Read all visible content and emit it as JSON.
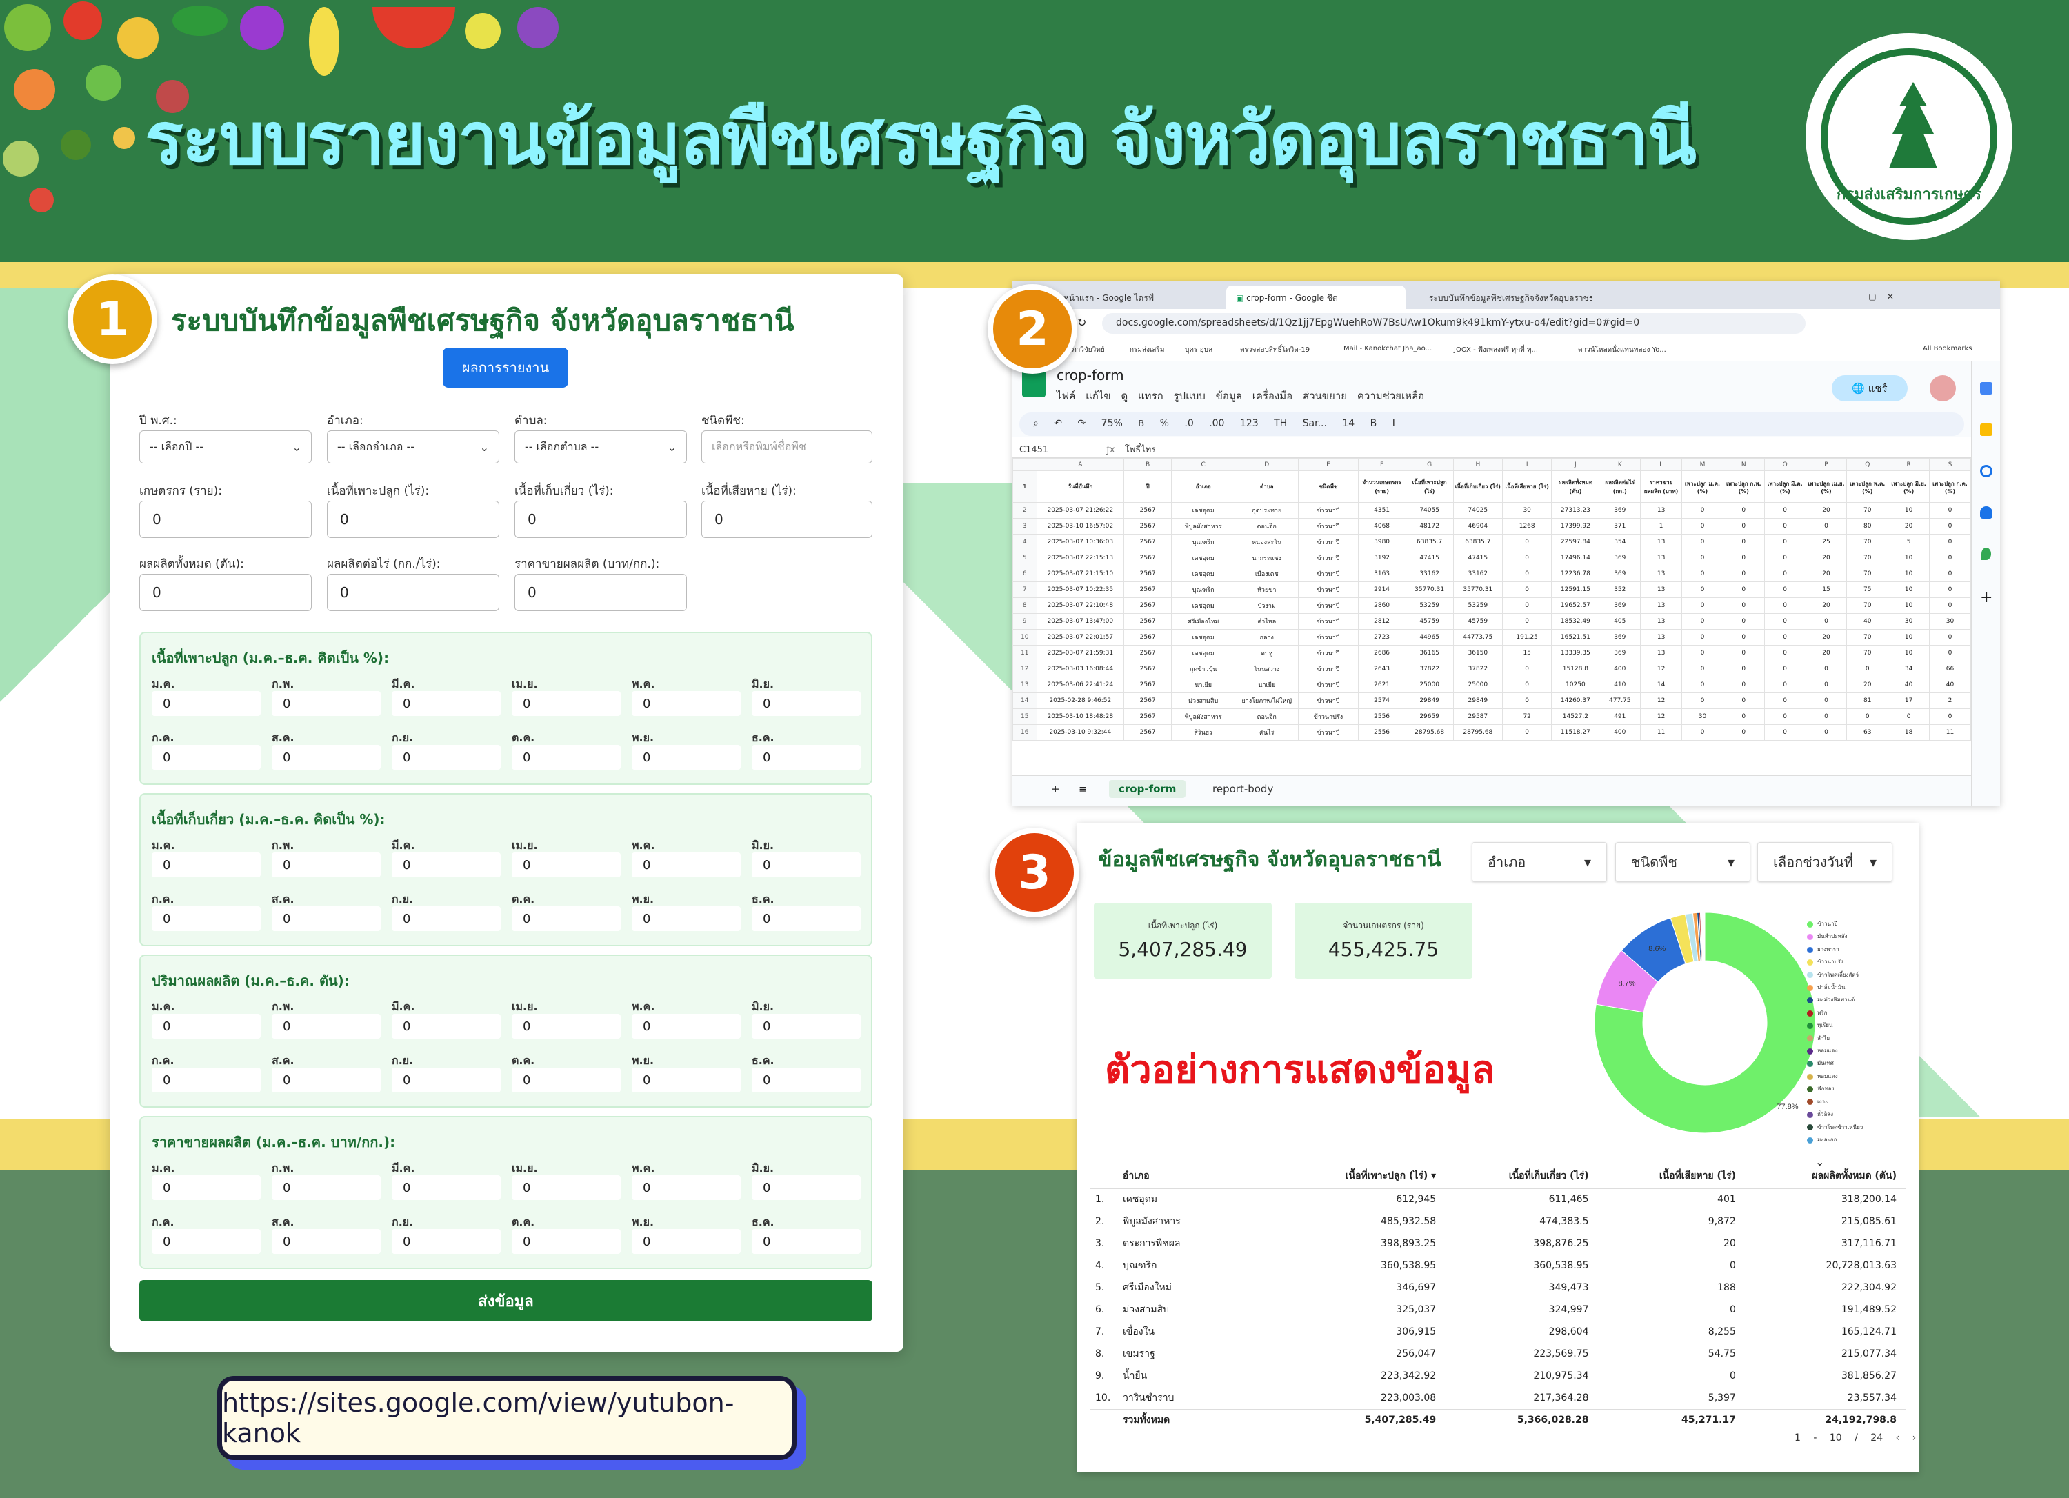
{
  "header": {
    "title": "ระบบรายงานข้อมูลพืชเศรษฐกิจ จังหวัดอุบลราชธานี",
    "seal_text": "กรมส่งเสริมการเกษตร"
  },
  "badges": [
    "1",
    "2",
    "3"
  ],
  "form": {
    "title": "ระบบบันทึกข้อมูลพืชเศรษฐกิจ จังหวัดอุบลราชธานี",
    "result_button": "ผลการรายงาน",
    "fields": {
      "year": {
        "label": "ปี พ.ศ.:",
        "value": "-- เลือกปี --"
      },
      "district": {
        "label": "อำเภอ:",
        "value": "-- เลือกอำเภอ --"
      },
      "subdistrict": {
        "label": "ตำบล:",
        "value": "-- เลือกตำบล --"
      },
      "crop": {
        "label": "ชนิดพืช:",
        "placeholder": "เลือกหรือพิมพ์ชื่อพืช"
      },
      "farmers": {
        "label": "เกษตรกร (ราย):",
        "value": "0"
      },
      "planted": {
        "label": "เนื้อที่เพาะปลูก (ไร่):",
        "value": "0"
      },
      "harvested": {
        "label": "เนื้อที่เก็บเกี่ยว (ไร่):",
        "value": "0"
      },
      "damaged": {
        "label": "เนื้อที่เสียหาย (ไร่):",
        "value": "0"
      },
      "total_yield": {
        "label": "ผลผลิตทั้งหมด (ตัน):",
        "value": "0"
      },
      "yield_per_rai": {
        "label": "ผลผลิตต่อไร่ (กก./ไร่):",
        "value": "0"
      },
      "price": {
        "label": "ราคาขายผลผลิต (บาท/กก.):",
        "value": "0"
      }
    },
    "months": [
      "ม.ค.",
      "ก.พ.",
      "มี.ค.",
      "เม.ย.",
      "พ.ค.",
      "มิ.ย.",
      "ก.ค.",
      "ส.ค.",
      "ก.ย.",
      "ต.ค.",
      "พ.ย.",
      "ธ.ค."
    ],
    "month_value": "0",
    "sections": [
      "เนื้อที่เพาะปลูก (ม.ค.–ธ.ค. คิดเป็น %):",
      "เนื้อที่เก็บเกี่ยว (ม.ค.–ธ.ค. คิดเป็น %):",
      "ปริมาณผลผลิต (ม.ค.–ธ.ค. ตัน):",
      "ราคาขายผลผลิต (ม.ค.–ธ.ค. บาท/กก.):"
    ],
    "submit": "ส่งข้อมูล"
  },
  "site_url": "https://sites.google.com/view/yutubon-kanok",
  "sheets": {
    "tabs": [
      "หน้าแรก - Google ไดรฟ์",
      "crop-form - Google ชีต",
      "ระบบบันทึกข้อมูลพืชเศรษฐกิจจังหวัดอุบลราชธานี"
    ],
    "url": "docs.google.com/spreadsheets/d/1Qz1jj7EpgWuehRoW7BsUAw1Okum9k491kmY-ytxu-o4/edit?gid=0#gid=0",
    "bookmarks": [
      "AI",
      "สภาวิจัยวิทย์",
      "กรมส่งเสริม",
      "บุคร อุบล",
      "ตรวจสอบสิทธิ์โควิด-19",
      "Mail - Kanokchat Jha_ao...",
      "JOOX - ฟังเพลงฟรี ทุกที่ ทุ...",
      "ดาวน์โหลดนั่งแทนพลอง Yo...",
      "All Bookmarks"
    ],
    "doc_title": "crop-form",
    "menu": [
      "ไฟล์",
      "แก้ไข",
      "ดู",
      "แทรก",
      "รูปแบบ",
      "ข้อมูล",
      "เครื่องมือ",
      "ส่วนขยาย",
      "ความช่วยเหลือ"
    ],
    "share": "แชร์",
    "toolbar": [
      "75%",
      "฿",
      "%",
      ".0",
      ".00",
      "123",
      "TH Sar...",
      "14",
      "B",
      "I"
    ],
    "cell_ref": "C1451",
    "formula": "โพธิ์ไทร",
    "col_letters": [
      "A",
      "B",
      "C",
      "D",
      "E",
      "F",
      "G",
      "H",
      "I",
      "J",
      "K",
      "L",
      "M",
      "N",
      "O",
      "P",
      "Q",
      "R",
      "S"
    ],
    "col_headers": [
      "วันที่บันทึก",
      "ปี",
      "อำเภอ",
      "ตำบล",
      "ชนิดพืช",
      "จำนวนเกษตรกร (ราย)",
      "เนื้อที่เพาะปลูก (ไร่)",
      "เนื้อที่เก็บเกี่ยว (ไร่)",
      "เนื้อที่เสียหาย (ไร่)",
      "ผลผลิตทั้งหมด (ตัน)",
      "ผลผลิตต่อไร่ (กก.)",
      "ราคาขาย ผลผลิต (บาท)",
      "เพาะปลูก ม.ค. (%)",
      "เพาะปลูก ก.พ. (%)",
      "เพาะปลูก มี.ค. (%)",
      "เพาะปลูก เม.ย. (%)",
      "เพาะปลูก พ.ค. (%)",
      "เพาะปลูก มิ.ย. (%)",
      "เพาะปลูก ก.ค. (%)"
    ],
    "rows": [
      [
        "2025-03-07 21:26:22",
        "2567",
        "เดชอุดม",
        "กุดประทาย",
        "ข้าวนาปี",
        "4351",
        "74055",
        "74025",
        "30",
        "27313.23",
        "369",
        "13",
        "0",
        "0",
        "0",
        "20",
        "70",
        "10",
        "0"
      ],
      [
        "2025-03-10 16:57:02",
        "2567",
        "พิบูลมังสาหาร",
        "ดอนจิก",
        "ข้าวนาปี",
        "4068",
        "48172",
        "46904",
        "1268",
        "17399.92",
        "371",
        "1",
        "0",
        "0",
        "0",
        "0",
        "80",
        "20",
        "0"
      ],
      [
        "2025-03-07 10:36:03",
        "2567",
        "บุณฑริก",
        "หนองสะโน",
        "ข้าวนาปี",
        "3980",
        "63835.7",
        "63835.7",
        "0",
        "22597.84",
        "354",
        "13",
        "0",
        "0",
        "0",
        "25",
        "70",
        "5",
        "0"
      ],
      [
        "2025-03-07 22:15:13",
        "2567",
        "เดชอุดม",
        "นากระแซง",
        "ข้าวนาปี",
        "3192",
        "47415",
        "47415",
        "0",
        "17496.14",
        "369",
        "13",
        "0",
        "0",
        "0",
        "20",
        "70",
        "10",
        "0"
      ],
      [
        "2025-03-07 21:15:10",
        "2567",
        "เดชอุดม",
        "เมืองเดช",
        "ข้าวนาปี",
        "3163",
        "33162",
        "33162",
        "0",
        "12236.78",
        "369",
        "13",
        "0",
        "0",
        "0",
        "20",
        "70",
        "10",
        "0"
      ],
      [
        "2025-03-07 10:22:35",
        "2567",
        "บุณฑริก",
        "ห้วยข่า",
        "ข้าวนาปี",
        "2914",
        "35770.31",
        "35770.31",
        "0",
        "12591.15",
        "352",
        "13",
        "0",
        "0",
        "0",
        "15",
        "75",
        "10",
        "0"
      ],
      [
        "2025-03-07 22:10:48",
        "2567",
        "เดชอุดม",
        "บัวงาม",
        "ข้าวนาปี",
        "2860",
        "53259",
        "53259",
        "0",
        "19652.57",
        "369",
        "13",
        "0",
        "0",
        "0",
        "20",
        "70",
        "10",
        "0"
      ],
      [
        "2025-03-07 13:47:00",
        "2567",
        "ศรีเมืองใหม่",
        "คำไหล",
        "ข้าวนาปี",
        "2812",
        "45759",
        "45759",
        "0",
        "18532.49",
        "405",
        "13",
        "0",
        "0",
        "0",
        "0",
        "40",
        "30",
        "30"
      ],
      [
        "2025-03-07 22:01:57",
        "2567",
        "เดชอุดม",
        "กลาง",
        "ข้าวนาปี",
        "2723",
        "44965",
        "44773.75",
        "191.25",
        "16521.51",
        "369",
        "13",
        "0",
        "0",
        "0",
        "20",
        "70",
        "10",
        "0"
      ],
      [
        "2025-03-07 21:59:31",
        "2567",
        "เดชอุดม",
        "ตบหู",
        "ข้าวนาปี",
        "2686",
        "36165",
        "36150",
        "15",
        "13339.35",
        "369",
        "13",
        "0",
        "0",
        "0",
        "20",
        "70",
        "10",
        "0"
      ],
      [
        "2025-03-03 16:08:44",
        "2567",
        "กุดข้าวปุ้น",
        "โนนสวาง",
        "ข้าวนาปี",
        "2643",
        "37822",
        "37822",
        "0",
        "15128.8",
        "400",
        "12",
        "0",
        "0",
        "0",
        "0",
        "0",
        "34",
        "66"
      ],
      [
        "2025-03-06 22:41:24",
        "2567",
        "นาเยีย",
        "นาเยีย",
        "ข้าวนาปี",
        "2621",
        "25000",
        "25000",
        "0",
        "10250",
        "410",
        "14",
        "0",
        "0",
        "0",
        "0",
        "20",
        "40",
        "40"
      ],
      [
        "2025-02-28 9:46:52",
        "2567",
        "ม่วงสามสิบ",
        "ยางโยภาพ/ไผ่ใหญ่",
        "ข้าวนาปี",
        "2574",
        "29849",
        "29849",
        "0",
        "14260.37",
        "477.75",
        "12",
        "0",
        "0",
        "0",
        "0",
        "81",
        "17",
        "2"
      ],
      [
        "2025-03-10 18:48:28",
        "2567",
        "พิบูลมังสาหาร",
        "ดอนจิก",
        "ข้าวนาปรัง",
        "2556",
        "29659",
        "29587",
        "72",
        "14527.2",
        "491",
        "12",
        "30",
        "0",
        "0",
        "0",
        "0",
        "0",
        "0"
      ],
      [
        "2025-03-10 9:32:44",
        "2567",
        "สิรินธร",
        "คันไร่",
        "ข้าวนาปี",
        "2556",
        "28795.68",
        "28795.68",
        "0",
        "11518.27",
        "400",
        "11",
        "0",
        "0",
        "0",
        "0",
        "63",
        "18",
        "11"
      ]
    ],
    "sheet_tabs": [
      "crop-form",
      "report-body"
    ]
  },
  "dashboard": {
    "title": "ข้อมูลพืชเศรษฐกิจ จังหวัดอุบลราชธานี",
    "filters": [
      "อำเภอ",
      "ชนิดพืช",
      "เลือกช่วงวันที่"
    ],
    "scorecards": [
      {
        "label": "เนื้อที่เพาะปลูก (ไร่)",
        "value": "5,407,285.49"
      },
      {
        "label": "จำนวนเกษตรกร (ราย)",
        "value": "455,425.75"
      }
    ],
    "example_label": "ตัวอย่างการแสดงข้อมูล",
    "chart_data": {
      "type": "pie",
      "donut": true,
      "labels": [
        "ข้าวนาปี",
        "มันสำปะหลัง",
        "ยางพารา",
        "ข้าวนาปรัง",
        "ข้าวโพดเลี้ยงสัตว์",
        "ปาล์มน้ำมัน",
        "มะม่วงหิมพานต์",
        "พริก",
        "ทุเรียน",
        "ลำไย",
        "หอมแดง",
        "มันเทศ",
        "หอมแดง",
        "ฟักทอง",
        "เงาะ",
        "ถั่วลิสง",
        "ข้าวโพดข้าวเหนียว",
        "มะละกอ"
      ],
      "values": [
        77.8,
        8.7,
        8.6,
        2.2,
        1.1,
        0.6,
        0.3,
        0.2,
        0.1,
        0.1,
        0.1,
        0.05,
        0.05,
        0.05,
        0.05,
        0.05,
        0.05,
        0.05
      ],
      "data_labels": [
        "77.8%",
        "8.7%",
        "8.6%"
      ],
      "colors": [
        "#6ff06a",
        "#ea87f4",
        "#2c6fd6",
        "#f4e25a",
        "#b7e3ee",
        "#f6a04d",
        "#1a4f8a",
        "#b21e1e",
        "#1f8f3a",
        "#c9a56b",
        "#5a2a8a",
        "#2a8a6a",
        "#d6b24a",
        "#3a6a2a",
        "#a04a2a",
        "#6a4a9a",
        "#2a4a3a",
        "#4aa0d6"
      ]
    },
    "table": {
      "headers": [
        "อำเภอ",
        "เนื้อที่เพาะปลูก (ไร่) ▾",
        "เนื้อที่เก็บเกี่ยว (ไร่)",
        "เนื้อที่เสียหาย (ไร่)",
        "ผลผลิตทั้งหมด (ตัน)"
      ],
      "rows": [
        [
          "1.",
          "เดชอุดม",
          "612,945",
          "611,465",
          "401",
          "318,200.14"
        ],
        [
          "2.",
          "พิบูลมังสาหาร",
          "485,932.58",
          "474,383.5",
          "9,872",
          "215,085.61"
        ],
        [
          "3.",
          "ตระการพืชผล",
          "398,893.25",
          "398,876.25",
          "20",
          "317,116.71"
        ],
        [
          "4.",
          "บุณฑริก",
          "360,538.95",
          "360,538.95",
          "0",
          "20,728,013.63"
        ],
        [
          "5.",
          "ศรีเมืองใหม่",
          "346,697",
          "349,473",
          "188",
          "222,304.92"
        ],
        [
          "6.",
          "ม่วงสามสิบ",
          "325,037",
          "324,997",
          "0",
          "191,489.52"
        ],
        [
          "7.",
          "เขื่องใน",
          "306,915",
          "298,604",
          "8,255",
          "165,124.71"
        ],
        [
          "8.",
          "เขมราฐ",
          "256,047",
          "223,569.75",
          "54.75",
          "215,077.34"
        ],
        [
          "9.",
          "น้ำยืน",
          "223,342.92",
          "210,975.34",
          "0",
          "381,856.27"
        ],
        [
          "10.",
          "วารินชำราบ",
          "223,003.08",
          "217,364.28",
          "5,397",
          "23,557.34"
        ]
      ],
      "total": [
        "รวมทั้งหมด",
        "5,407,285.49",
        "5,366,028.28",
        "45,271.17",
        "24,192,798.8"
      ],
      "pager": "1 - 10 / 24"
    }
  }
}
